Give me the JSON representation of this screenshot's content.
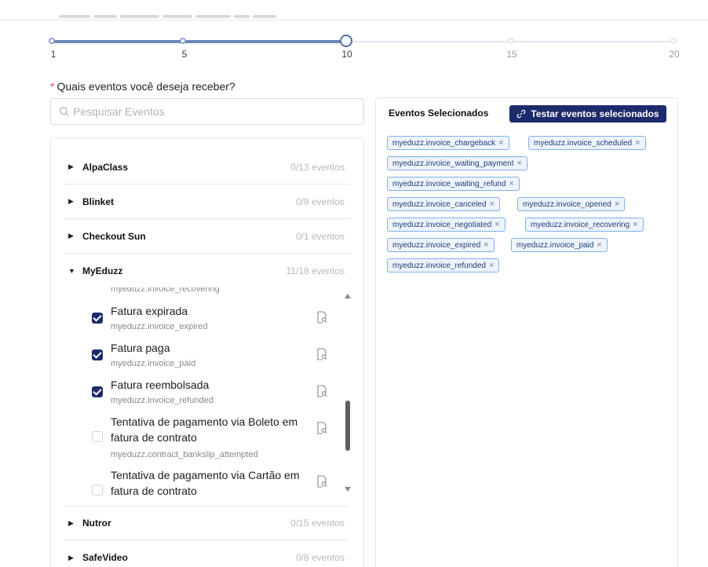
{
  "slider": {
    "ticks": [
      "1",
      "5",
      "10",
      "15",
      "20"
    ],
    "value": 10
  },
  "question": {
    "required_mark": "*",
    "label": "Quais eventos você deseja receber?"
  },
  "search": {
    "placeholder": "Pesquisar Eventos"
  },
  "groups": [
    {
      "name": "AlpaClass",
      "count": "0/13 eventos",
      "expanded": false
    },
    {
      "name": "Blinket",
      "count": "0/8 eventos",
      "expanded": false
    },
    {
      "name": "Checkout Sun",
      "count": "0/1 eventos",
      "expanded": false
    },
    {
      "name": "MyEduzz",
      "count": "11/18 eventos",
      "expanded": true
    },
    {
      "name": "Nutror",
      "count": "0/15 eventos",
      "expanded": false
    },
    {
      "name": "SafeVideo",
      "count": "0/8 eventos",
      "expanded": false
    }
  ],
  "events": {
    "partial_key": "myeduzz.invoice_recovering",
    "items": [
      {
        "title": "Fatura expirada",
        "key": "myeduzz.invoice_expired",
        "checked": true
      },
      {
        "title": "Fatura paga",
        "key": "myeduzz.invoice_paid",
        "checked": true
      },
      {
        "title": "Fatura reembolsada",
        "key": "myeduzz.invoice_refunded",
        "checked": true
      },
      {
        "title": "Tentativa de pagamento via Boleto em fatura de contrato",
        "key": "myeduzz.contract_bankslip_attempted",
        "checked": false
      },
      {
        "title": "Tentativa de pagamento via Cartão em fatura de contrato",
        "key": "",
        "checked": false
      }
    ]
  },
  "panel": {
    "title": "Eventos Selecionados",
    "test_button": "Testar eventos selecionados",
    "tags": [
      "myeduzz.invoice_chargeback",
      "myeduzz.invoice_scheduled",
      "myeduzz.invoice_waiting_payment",
      "myeduzz.invoice_waiting_refund",
      "myeduzz.invoice_canceled",
      "myeduzz.invoice_opened",
      "myeduzz.invoice_negotiated",
      "myeduzz.invoice_recovering",
      "myeduzz.invoice_expired",
      "myeduzz.invoice_paid",
      "myeduzz.invoice_refunded"
    ],
    "tag_remove": "×"
  },
  "colors": {
    "accent": "#1d2a6b",
    "slider": "#4f6fb0",
    "tag_border": "#7fb0ee",
    "required": "#e5484d"
  }
}
